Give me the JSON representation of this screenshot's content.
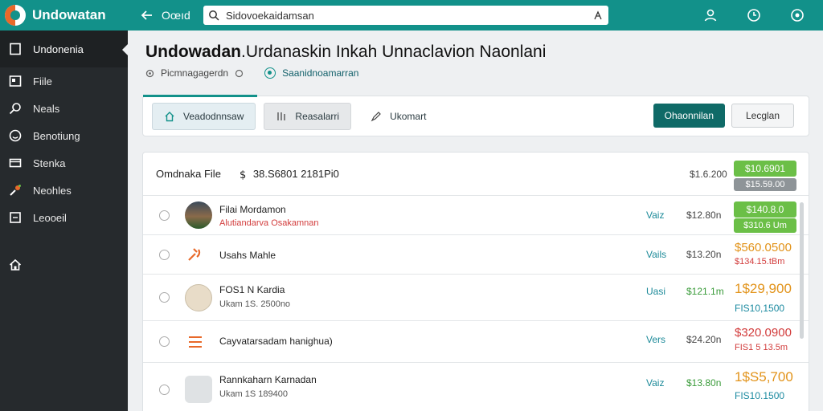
{
  "app": {
    "name": "Undowatan"
  },
  "topbar": {
    "back_label": "Oœıd",
    "search_value": "Sidovoekaidamsan",
    "icons": [
      "user-icon",
      "clock-icon",
      "settings-icon"
    ]
  },
  "sidebar": {
    "items": [
      {
        "label": "Undonenia",
        "icon": "square-icon",
        "active": true
      },
      {
        "label": "Fiile",
        "icon": "file-icon"
      },
      {
        "label": "Neals",
        "icon": "search-icon"
      },
      {
        "label": "Benotiung",
        "icon": "smile-icon"
      },
      {
        "label": "Stenka",
        "icon": "card-icon"
      },
      {
        "label": "Neohles",
        "icon": "paint-icon"
      },
      {
        "label": "Leooeil",
        "icon": "box-icon"
      }
    ]
  },
  "page": {
    "title_bold": "Undowadan",
    "title_rest": ".Urdanaskin Inkah Unnaclavion Naonlani",
    "crumb_1": "Picmnagagerdn",
    "crumb_2": "Saanidnoamarran"
  },
  "toolbar": {
    "tab_1": "Veadodnnsaw",
    "tab_2": "Reasalarri",
    "tab_3": "Ukomart",
    "primary_button": "Ohaonnilan",
    "secondary_button": "Lecglan"
  },
  "table": {
    "header": {
      "label": "Omdnaka File",
      "total": "38.S6801 2181Pi0",
      "col": "$1.6.200",
      "badge_top": "$10.6901",
      "badge_bottom": "$15.59.00"
    },
    "rows": [
      {
        "name": "Filai Mordamon",
        "sub": "Alutiandarva Osakamnan",
        "version": "Vaiz",
        "price": "$12.80n",
        "amount": "$140.8.0",
        "amount2": "$310.6 Um"
      },
      {
        "name": "Usahs Mahle",
        "sub": "",
        "version": "Vails",
        "price": "$13.20n",
        "amount": "$560.0500",
        "amount2": "$134.15.tBm"
      },
      {
        "name": "FOS1 N Kardia",
        "sub": "Ukam 1S. 2500no",
        "version": "Uasi",
        "price": "$121.1m",
        "amount": "1$29,900",
        "amount2": "FIS10,1500"
      },
      {
        "name": "Cayvatarsadam hanighua)",
        "sub": "",
        "version": "Vers",
        "price": "$24.20n",
        "amount": "$320.0900",
        "amount2": "FIS1 5 13.5m"
      },
      {
        "name": "Rannkaharn Karnadan",
        "sub": "Ukam 1S 189400",
        "version": "Vaiz",
        "price": "$13.80n",
        "amount": "1$S5,700",
        "amount2": "FIS10.1500"
      }
    ]
  },
  "colors": {
    "brand": "#12918a",
    "sidebar": "#262a2d",
    "primary": "#0f6a67"
  }
}
